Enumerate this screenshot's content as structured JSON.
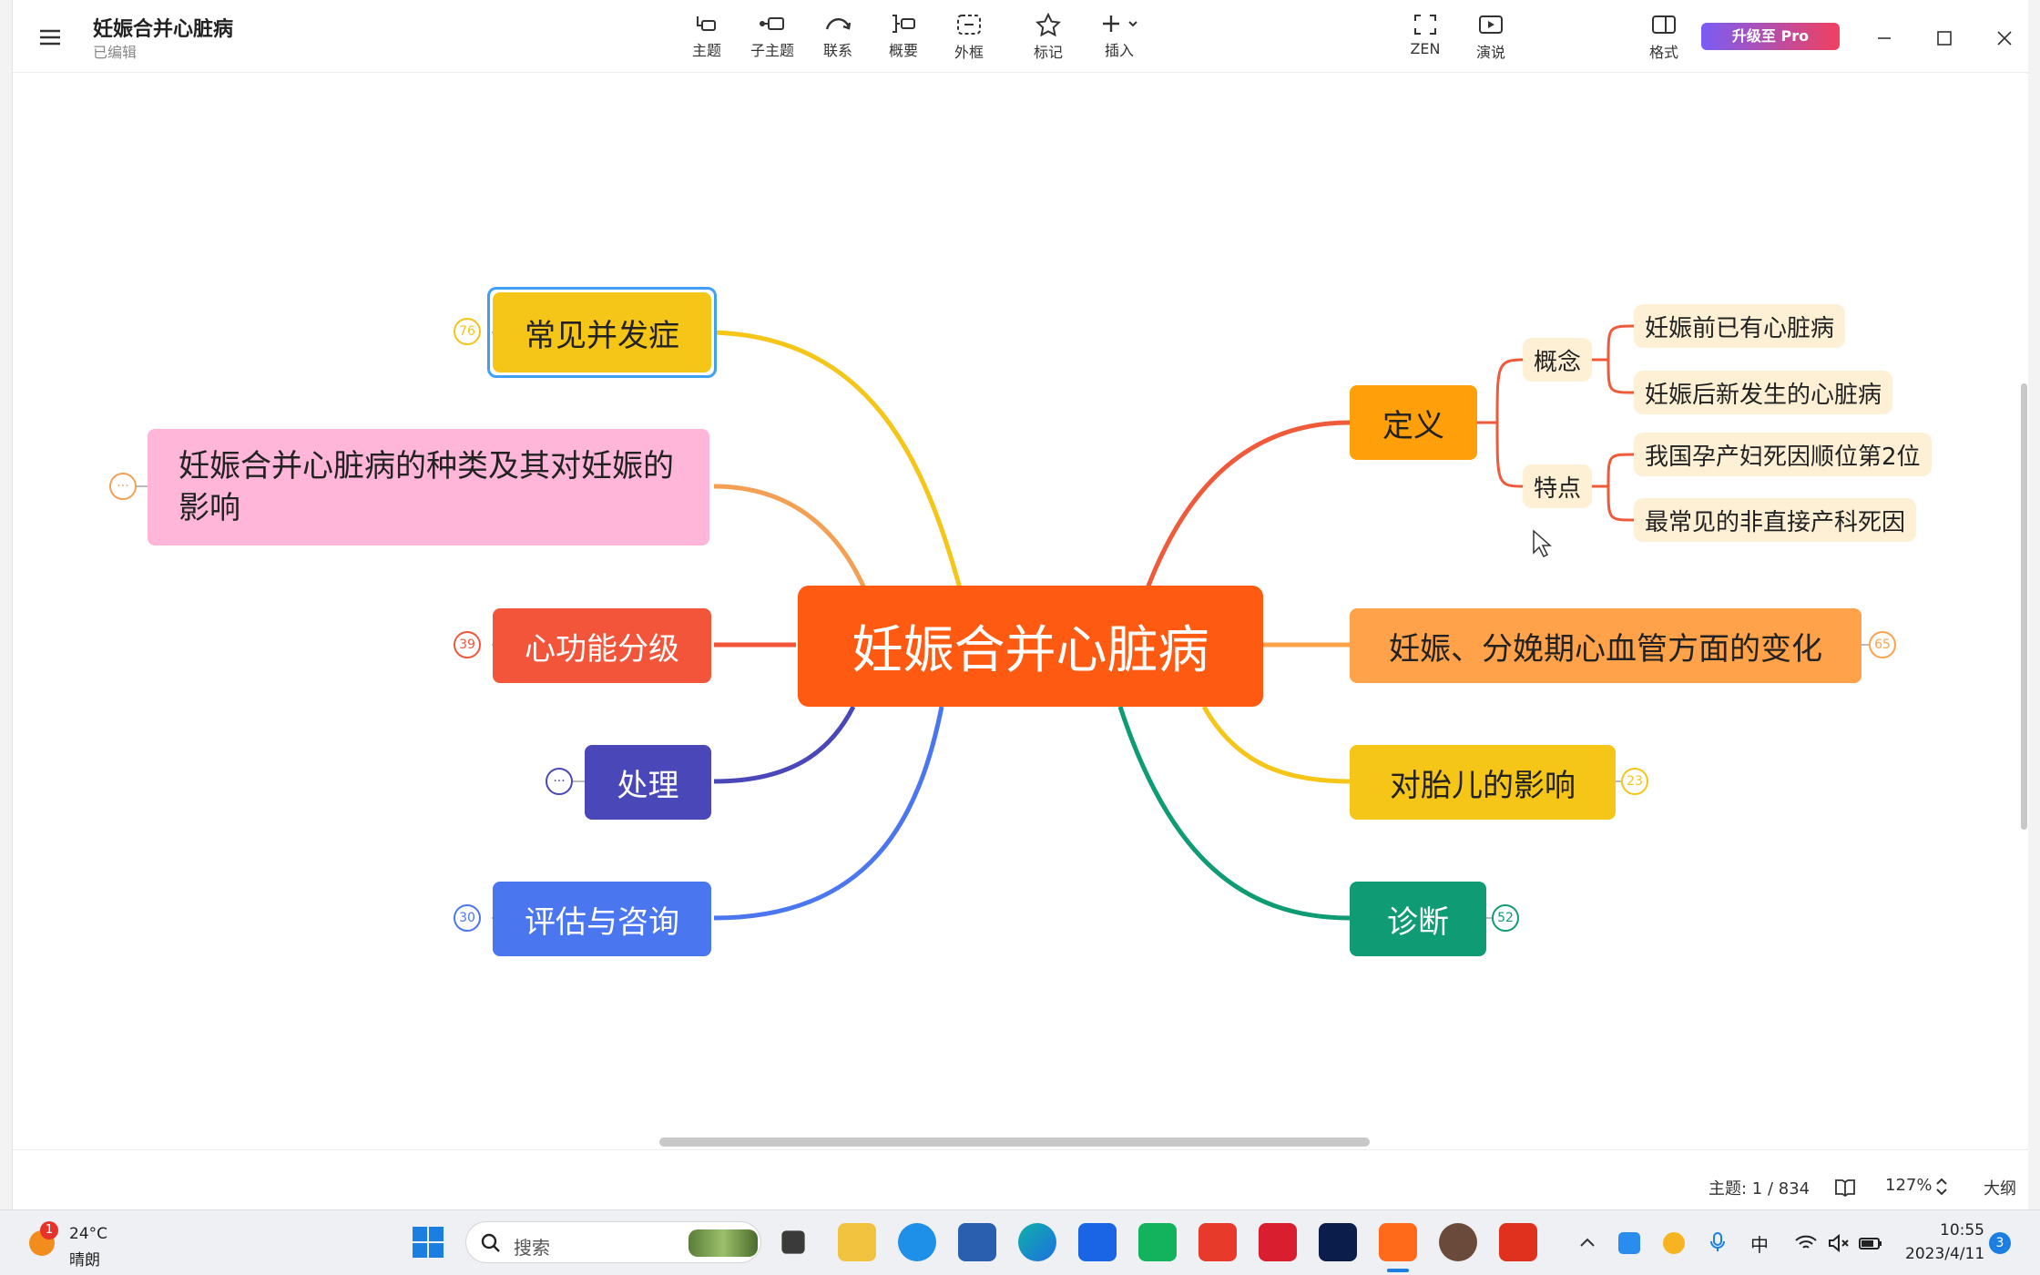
{
  "doc": {
    "title": "妊娠合并心脏病",
    "status": "已编辑"
  },
  "toolbar": {
    "topic": "主题",
    "subtopic": "子主题",
    "relation": "联系",
    "summary": "概要",
    "boundary": "外框",
    "marker": "标记",
    "insert": "插入",
    "zen": "ZEN",
    "present": "演说",
    "format": "格式",
    "pro": "升级至 Pro"
  },
  "map": {
    "central": "妊娠合并心脏病",
    "left": [
      {
        "label": "常见并发症",
        "badge": "76",
        "color": "#f5c518"
      },
      {
        "label": "妊娠合并心脏病的种类及其对妊娠的影响",
        "badge": "···",
        "color": "#ffb6d9"
      },
      {
        "label": "心功能分级",
        "badge": "39",
        "color": "#f3553b"
      },
      {
        "label": "处理",
        "badge": "···",
        "color": "#4a47b8"
      },
      {
        "label": "评估与咨询",
        "badge": "30",
        "color": "#4a77f0"
      }
    ],
    "right": [
      {
        "label": "定义",
        "color": "#ff9f0a",
        "children": [
          {
            "label": "概念",
            "children": [
              "妊娠前已有心脏病",
              "妊娠后新发生的心脏病"
            ]
          },
          {
            "label": "特点",
            "children": [
              "我国孕产妇死因顺位第2位",
              "最常见的非直接产科死因"
            ]
          }
        ]
      },
      {
        "label": "妊娠、分娩期心血管方面的变化",
        "badge": "65",
        "color": "#ffa24a"
      },
      {
        "label": "对胎儿的影响",
        "badge": "23",
        "color": "#f5c518"
      },
      {
        "label": "诊断",
        "badge": "52",
        "color": "#0f9b73"
      }
    ]
  },
  "statusbar": {
    "topics": "主题: 1 / 834",
    "zoom": "127%",
    "outline": "大纲"
  },
  "taskbar": {
    "weather_temp": "24°C",
    "weather_desc": "晴朗",
    "weather_alert": "1",
    "search_placeholder": "搜索",
    "ime": "中",
    "time": "10:55",
    "date": "2023/4/11",
    "notif_count": "3"
  }
}
